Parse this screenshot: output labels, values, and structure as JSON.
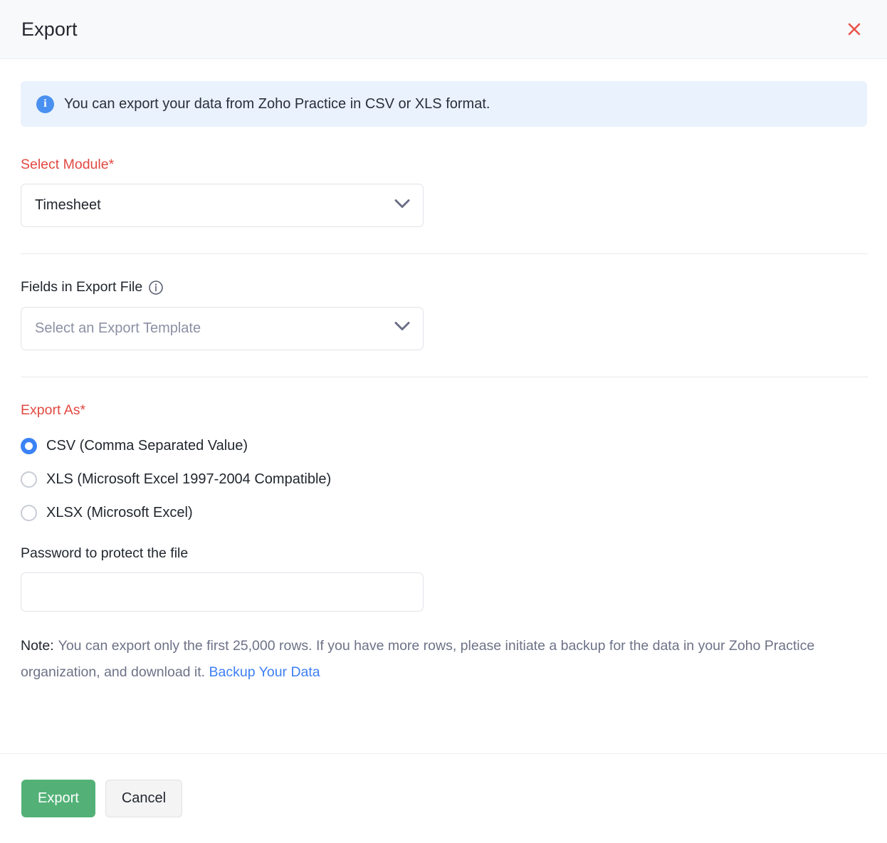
{
  "header": {
    "title": "Export",
    "close_icon": "close-icon"
  },
  "banner": {
    "icon": "info-circle-filled-icon",
    "message": "You can export your data from Zoho Practice in CSV or XLS format.",
    "background_color": "#eaf2fd",
    "icon_color": "#4a90f0"
  },
  "module_field": {
    "label": "Select Module*",
    "label_color": "#e14942",
    "selected_value": "Timesheet",
    "chevron_icon": "chevron-down-icon"
  },
  "fields_field": {
    "label": "Fields in Export File",
    "info_icon": "info-circle-outline-icon",
    "placeholder": "Select an Export Template",
    "chevron_icon": "chevron-down-icon"
  },
  "export_as": {
    "label": "Export As*",
    "label_color": "#e14942",
    "selected": "csv",
    "accent_color": "#3b82f6",
    "options": [
      {
        "id": "csv",
        "label": "CSV (Comma Separated Value)",
        "checked": true
      },
      {
        "id": "xls",
        "label": "XLS (Microsoft Excel 1997-2004 Compatible)",
        "checked": false
      },
      {
        "id": "xlsx",
        "label": "XLSX (Microsoft Excel)",
        "checked": false
      }
    ]
  },
  "password": {
    "label": "Password to protect the file",
    "value": "",
    "placeholder": ""
  },
  "note": {
    "label": "Note:",
    "text": "You can export only the first 25,000 rows. If you have more rows, please initiate a backup for the data in your Zoho Practice organization, and download it.",
    "link_text": "Backup Your Data",
    "link_color": "#3d7ff3"
  },
  "footer": {
    "primary_label": "Export",
    "primary_color": "#53b177",
    "secondary_label": "Cancel"
  }
}
